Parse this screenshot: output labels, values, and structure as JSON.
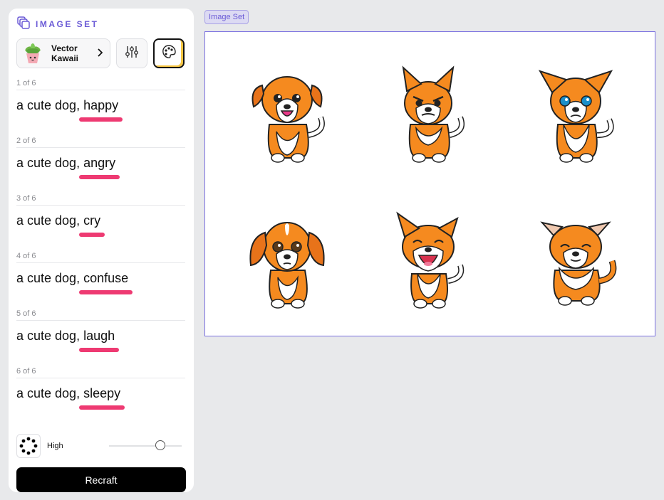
{
  "panel": {
    "title": "IMAGE SET",
    "style": {
      "name": "Vector Kawaii",
      "icon": "plant-pot-icon"
    },
    "prompts": [
      {
        "count": "1 of 6",
        "base": "a cute dog,",
        "word": "happy"
      },
      {
        "count": "2 of 6",
        "base": "a cute dog,",
        "word": "angry"
      },
      {
        "count": "3 of 6",
        "base": "a cute dog,",
        "word": "cry"
      },
      {
        "count": "4 of 6",
        "base": "a cute dog,",
        "word": "confuse"
      },
      {
        "count": "5 of 6",
        "base": "a cute dog,",
        "word": "laugh"
      },
      {
        "count": "6 of 6",
        "base": "a cute dog,",
        "word": "sleepy"
      }
    ],
    "quality": {
      "label": "High",
      "level": 0.74
    },
    "button": "Recraft"
  },
  "canvas": {
    "tag": "Image Set",
    "images": [
      {
        "expression": "happy"
      },
      {
        "expression": "angry"
      },
      {
        "expression": "cry"
      },
      {
        "expression": "confuse"
      },
      {
        "expression": "laugh"
      },
      {
        "expression": "sleepy"
      }
    ]
  },
  "colors": {
    "accent": "#6b5bd6",
    "highlight": "#ee3a72",
    "dog": "#f58a1f",
    "button": "#000000"
  }
}
